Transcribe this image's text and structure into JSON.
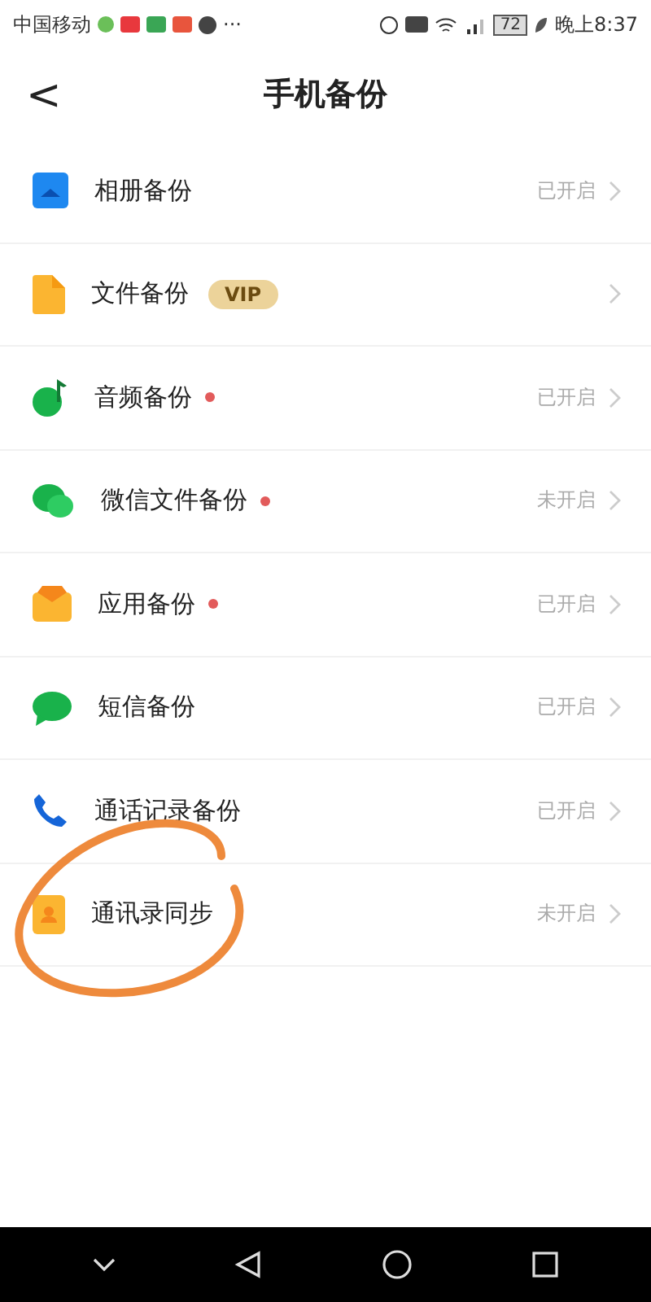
{
  "status_bar": {
    "carrier": "中国移动",
    "more": "···",
    "battery": "72",
    "time": "晚上8:37"
  },
  "header": {
    "back": "<",
    "title": "手机备份"
  },
  "items": [
    {
      "kind": "photo",
      "label": "相册备份",
      "dot": false,
      "status": "已开启"
    },
    {
      "kind": "file",
      "label": "文件备份",
      "dot": false,
      "badge": "VIP"
    },
    {
      "kind": "audio",
      "label": "音频备份",
      "dot": true,
      "status": "已开启"
    },
    {
      "kind": "wechat",
      "label": "微信文件备份",
      "dot": true,
      "status": "未开启"
    },
    {
      "kind": "app",
      "label": "应用备份",
      "dot": true,
      "status": "已开启"
    },
    {
      "kind": "sms",
      "label": "短信备份",
      "dot": false,
      "status": "已开启"
    },
    {
      "kind": "call",
      "label": "通话记录备份",
      "dot": false,
      "status": "已开启"
    },
    {
      "kind": "contacts",
      "label": "通讯录同步",
      "dot": false,
      "status": "未开启",
      "circled": true
    }
  ]
}
